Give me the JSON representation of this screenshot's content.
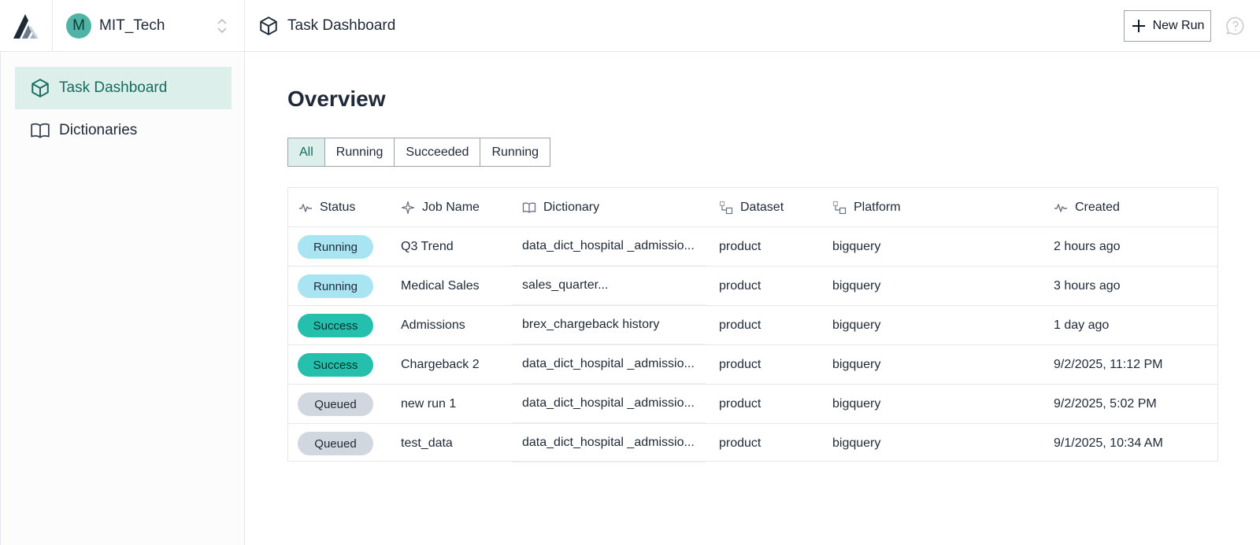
{
  "org": {
    "avatar_initial": "M",
    "name": "MIT_Tech"
  },
  "header": {
    "title": "Task Dashboard",
    "new_run_label": "New Run"
  },
  "sidebar": {
    "items": [
      {
        "label": "Task Dashboard",
        "icon": "cube-icon",
        "active": true
      },
      {
        "label": "Dictionaries",
        "icon": "book-icon",
        "active": false
      }
    ]
  },
  "main": {
    "title": "Overview",
    "filters": [
      "All",
      "Running",
      "Succeeded",
      "Running"
    ],
    "active_filter": "All"
  },
  "table": {
    "columns": [
      "Status",
      "Job Name",
      "Dictionary",
      "Dataset",
      "Platform",
      "Created"
    ],
    "rows": [
      {
        "status": "Running",
        "job": "Q3 Trend",
        "dictionary": "data_dict_hospital _admissio...",
        "dataset": "product",
        "platform": "bigquery",
        "created": "2 hours ago"
      },
      {
        "status": "Running",
        "job": "Medical Sales",
        "dictionary": "sales_quarter...",
        "dataset": "product",
        "platform": "bigquery",
        "created": "3 hours ago"
      },
      {
        "status": "Success",
        "job": "Admissions",
        "dictionary": "brex_chargeback history",
        "dataset": "product",
        "platform": "bigquery",
        "created": "1 day ago"
      },
      {
        "status": "Success",
        "job": "Chargeback 2",
        "dictionary": "data_dict_hospital _admissio...",
        "dataset": "product",
        "platform": "bigquery",
        "created": "9/2/2025, 11:12 PM"
      },
      {
        "status": "Queued",
        "job": "new run 1",
        "dictionary": "data_dict_hospital _admissio...",
        "dataset": "product",
        "platform": "bigquery",
        "created": "9/2/2025, 5:02 PM"
      },
      {
        "status": "Queued",
        "job": "test_data",
        "dictionary": "data_dict_hospital _admissio...",
        "dataset": "product",
        "platform": "bigquery",
        "created": "9/1/2025, 10:34 AM"
      }
    ]
  },
  "colors": {
    "accent": "#166b5f",
    "active_bg": "#dcefeb",
    "running": "#a9e4f3",
    "success": "#24bfad",
    "queued": "#d1d7de",
    "avatar": "#4fb3a6"
  }
}
